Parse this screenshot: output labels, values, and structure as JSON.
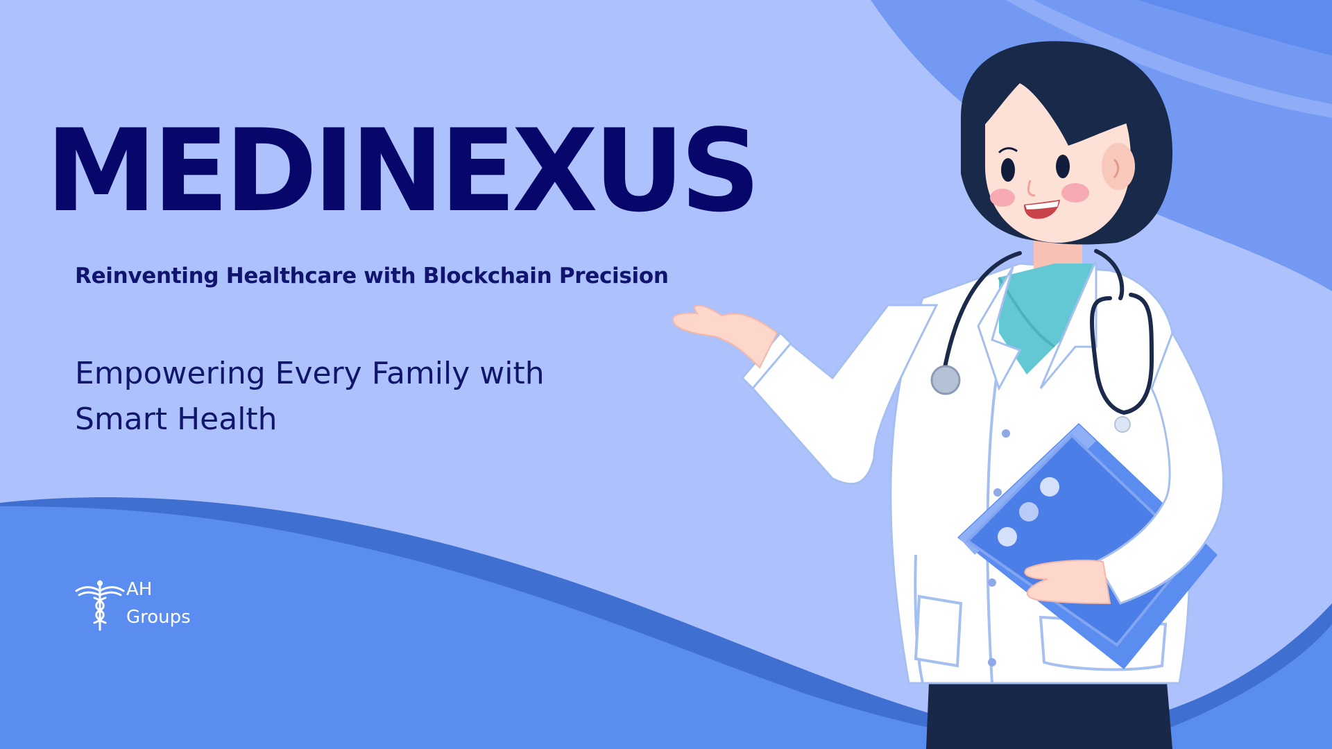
{
  "slide": {
    "brand_title": "MEDINEXUS",
    "tagline": "Reinventing Healthcare with Blockchain Precision",
    "subtitle_lines": [
      "Empowering Every Family with",
      "Smart Health"
    ]
  },
  "logo": {
    "icon": "caduceus-icon",
    "line1": "AH",
    "line2": "Groups"
  },
  "illustration": {
    "subject": "doctor-illustration",
    "clipboard_icon": "clipboard-icon",
    "stethoscope_icon": "stethoscope-icon"
  },
  "colors": {
    "background": "#adc1fd",
    "wave_dark": "#3e6fd1",
    "wave_mid": "#5a8aee",
    "wave_top": "#7399f3",
    "title": "#06066b",
    "text": "#12166b",
    "white": "#ffffff"
  }
}
